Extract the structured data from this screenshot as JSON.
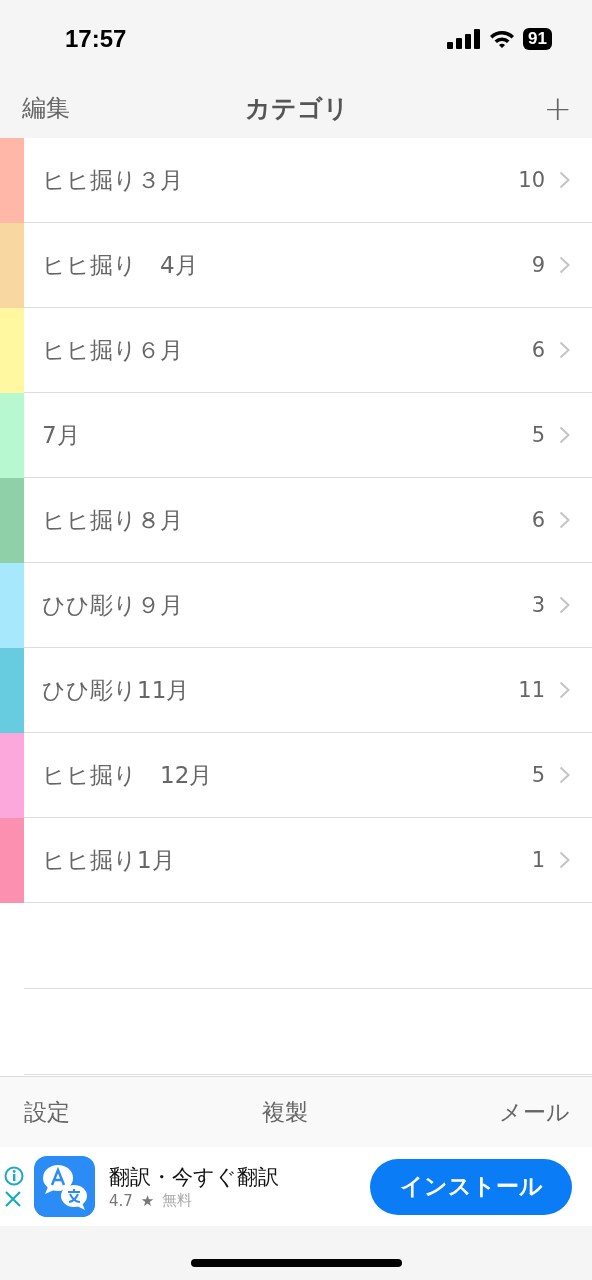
{
  "status_bar": {
    "time": "17:57",
    "battery": "91"
  },
  "nav": {
    "left": "編集",
    "title": "カテゴリ",
    "right": "+"
  },
  "categories": [
    {
      "name": "ヒヒ掘り３月",
      "count": "10",
      "color": "#ffb8a8"
    },
    {
      "name": "ヒヒ掘り　4月",
      "count": "9",
      "color": "#f8d8a0"
    },
    {
      "name": "ヒヒ掘り６月",
      "count": "6",
      "color": "#fff8a0"
    },
    {
      "name": "7月",
      "count": "5",
      "color": "#b8f8d0"
    },
    {
      "name": "ヒヒ掘り８月",
      "count": "6",
      "color": "#90d0a8"
    },
    {
      "name": "ひひ彫り９月",
      "count": "3",
      "color": "#a8e8fc"
    },
    {
      "name": "ひひ彫り11月",
      "count": "11",
      "color": "#68cce0"
    },
    {
      "name": "ヒヒ掘り　12月",
      "count": "5",
      "color": "#fca8dc"
    },
    {
      "name": "ヒヒ掘り1月",
      "count": "1",
      "color": "#fc90b0"
    }
  ],
  "toolbar": [
    "設定",
    "複製",
    "メール"
  ],
  "ad": {
    "title": "翻訳・今すぐ翻訳",
    "rating": "4.7",
    "star": "★",
    "price": "無料",
    "button": "インストール"
  }
}
